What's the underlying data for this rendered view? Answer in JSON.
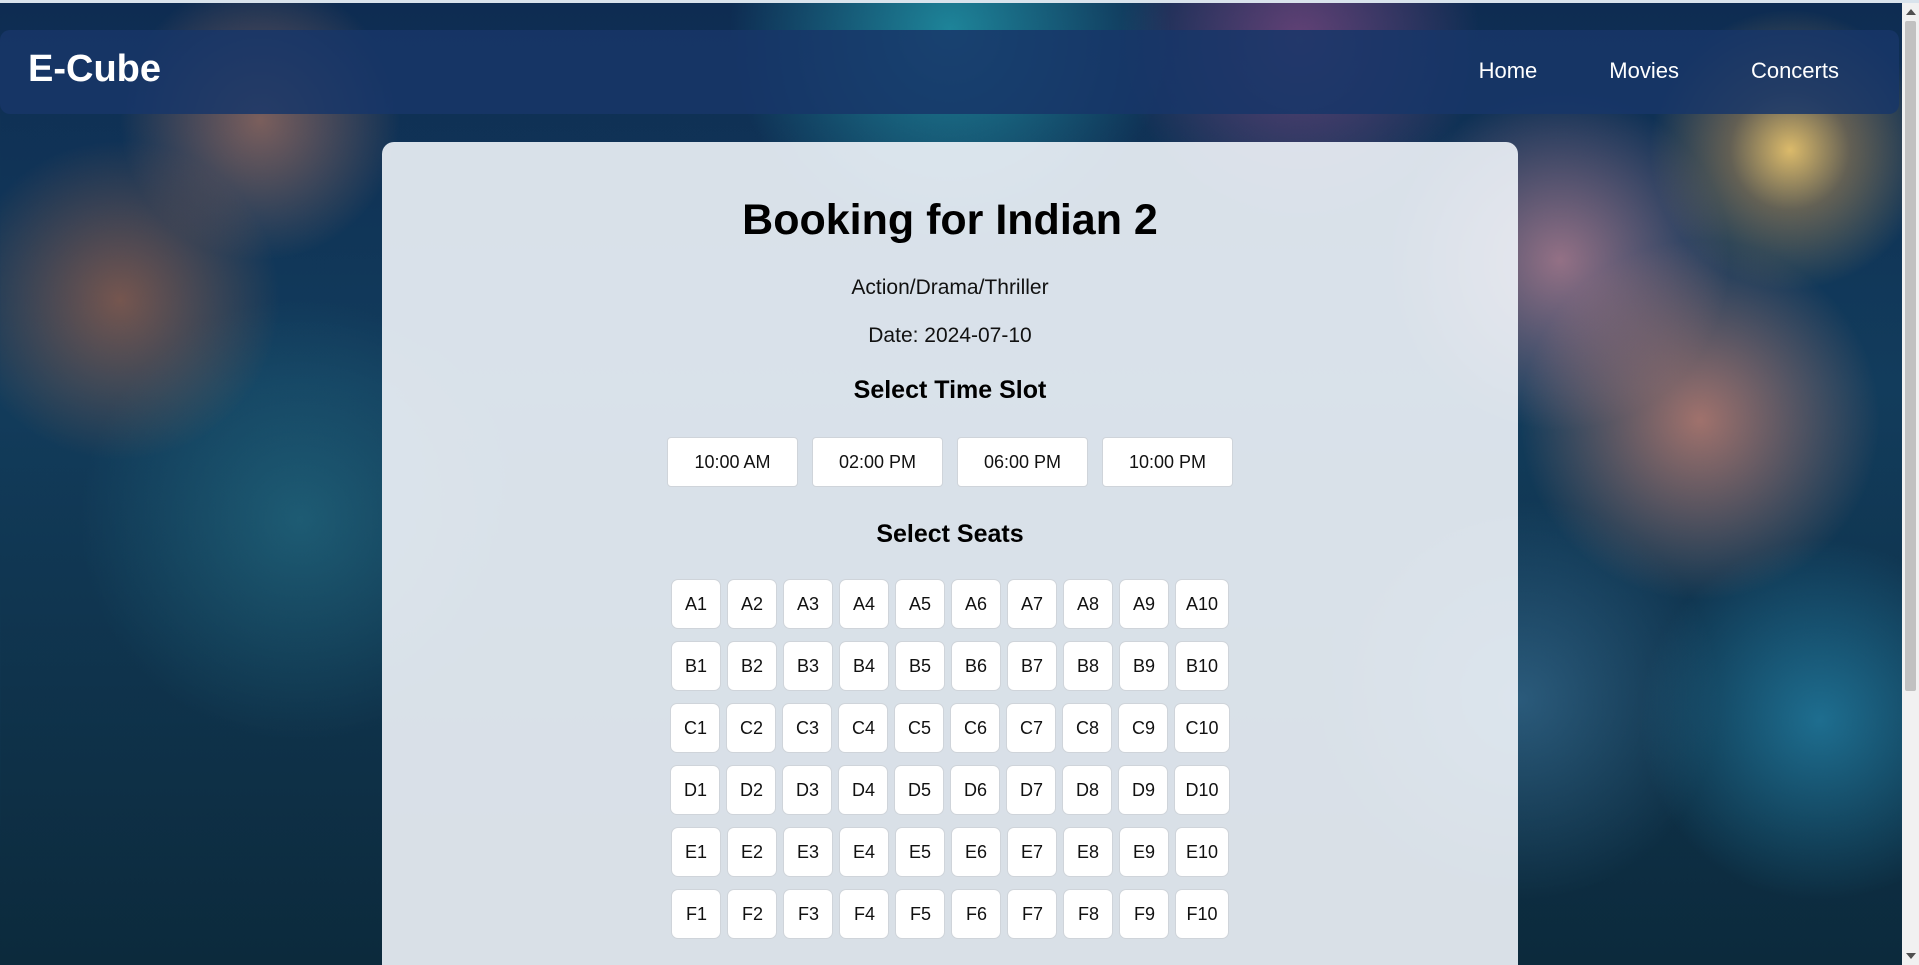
{
  "navbar": {
    "brand": "E-Cube",
    "links": [
      {
        "label": "Home"
      },
      {
        "label": "Movies"
      },
      {
        "label": "Concerts"
      }
    ]
  },
  "booking": {
    "title": "Booking for Indian 2",
    "genre": "Action/Drama/Thriller",
    "date_text": "Date: 2024-07-10",
    "time_section_title": "Select Time Slot",
    "time_slots": [
      "10:00 AM",
      "02:00 PM",
      "06:00 PM",
      "10:00 PM"
    ],
    "seats_section_title": "Select Seats",
    "seat_rows": [
      [
        "A1",
        "A2",
        "A3",
        "A4",
        "A5",
        "A6",
        "A7",
        "A8",
        "A9",
        "A10"
      ],
      [
        "B1",
        "B2",
        "B3",
        "B4",
        "B5",
        "B6",
        "B7",
        "B8",
        "B9",
        "B10"
      ],
      [
        "C1",
        "C2",
        "C3",
        "C4",
        "C5",
        "C6",
        "C7",
        "C8",
        "C9",
        "C10"
      ],
      [
        "D1",
        "D2",
        "D3",
        "D4",
        "D5",
        "D6",
        "D7",
        "D8",
        "D9",
        "D10"
      ],
      [
        "E1",
        "E2",
        "E3",
        "E4",
        "E5",
        "E6",
        "E7",
        "E8",
        "E9",
        "E10"
      ],
      [
        "F1",
        "F2",
        "F3",
        "F4",
        "F5",
        "F6",
        "F7",
        "F8",
        "F9",
        "F10"
      ]
    ]
  }
}
